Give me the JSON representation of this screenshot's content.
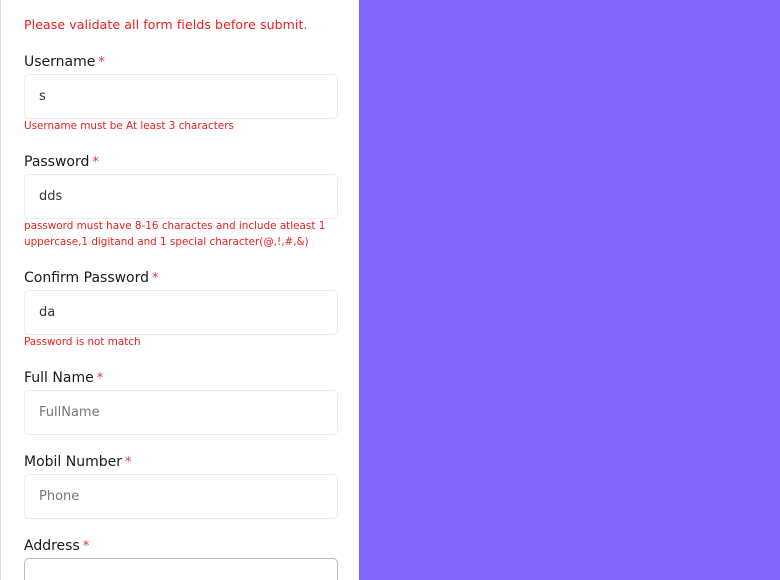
{
  "form": {
    "alert": "Please validate all form fields before submit.",
    "required_marker": "*",
    "username": {
      "label": "Username",
      "value": "s",
      "error": "Username must be At least 3 characters"
    },
    "password": {
      "label": "Password",
      "value": "dds",
      "error": "password must have 8-16 charactes and include atleast 1 uppercase,1 digitand and 1 special character(@,!,#,&)"
    },
    "confirm_password": {
      "label": "Confirm Password",
      "value": "da",
      "error": "Password is not match"
    },
    "full_name": {
      "label": "Full Name",
      "value": "",
      "placeholder": "FullName"
    },
    "mobile_number": {
      "label": "Mobil Number",
      "value": "",
      "placeholder": "Phone"
    },
    "address": {
      "label": "Address",
      "value": ""
    }
  },
  "colors": {
    "side_panel": "#8167fb",
    "error_text": "#ee1c1c",
    "required_marker": "#e53935"
  }
}
